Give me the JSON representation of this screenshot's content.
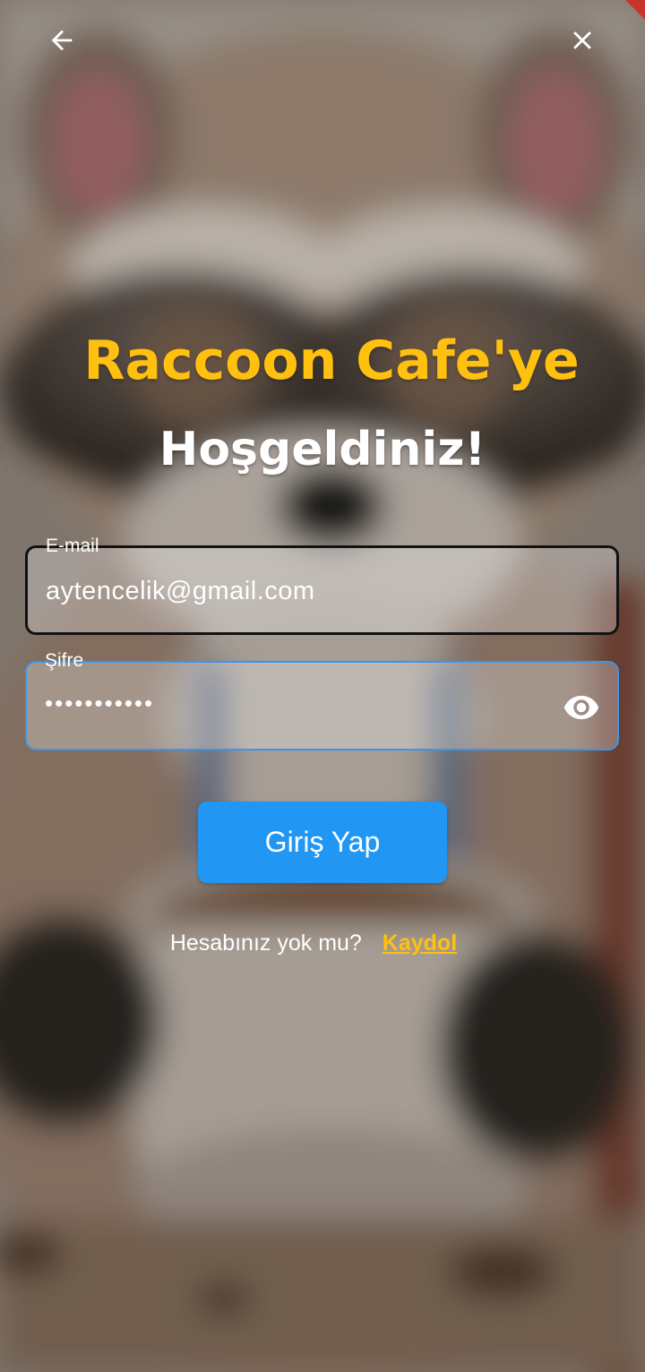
{
  "header": {
    "back_icon": "arrow-left-icon",
    "close_icon": "close-icon"
  },
  "welcome": {
    "title_line1": "Raccoon Cafe'ye",
    "title_line2": "Hoşgeldiniz!"
  },
  "form": {
    "email": {
      "label": "E-mail",
      "value": "aytencelik@gmail.com"
    },
    "password": {
      "label": "Şifre",
      "value": "•••••••••••",
      "toggle_icon": "eye-icon"
    },
    "login_label": "Giriş Yap"
  },
  "signup": {
    "prompt": "Hesabınız yok mu?",
    "link_label": "Kaydol"
  },
  "colors": {
    "accent_yellow": "#ffc00f",
    "button_blue": "#2196f3",
    "focus_border": "#3d95e8"
  }
}
